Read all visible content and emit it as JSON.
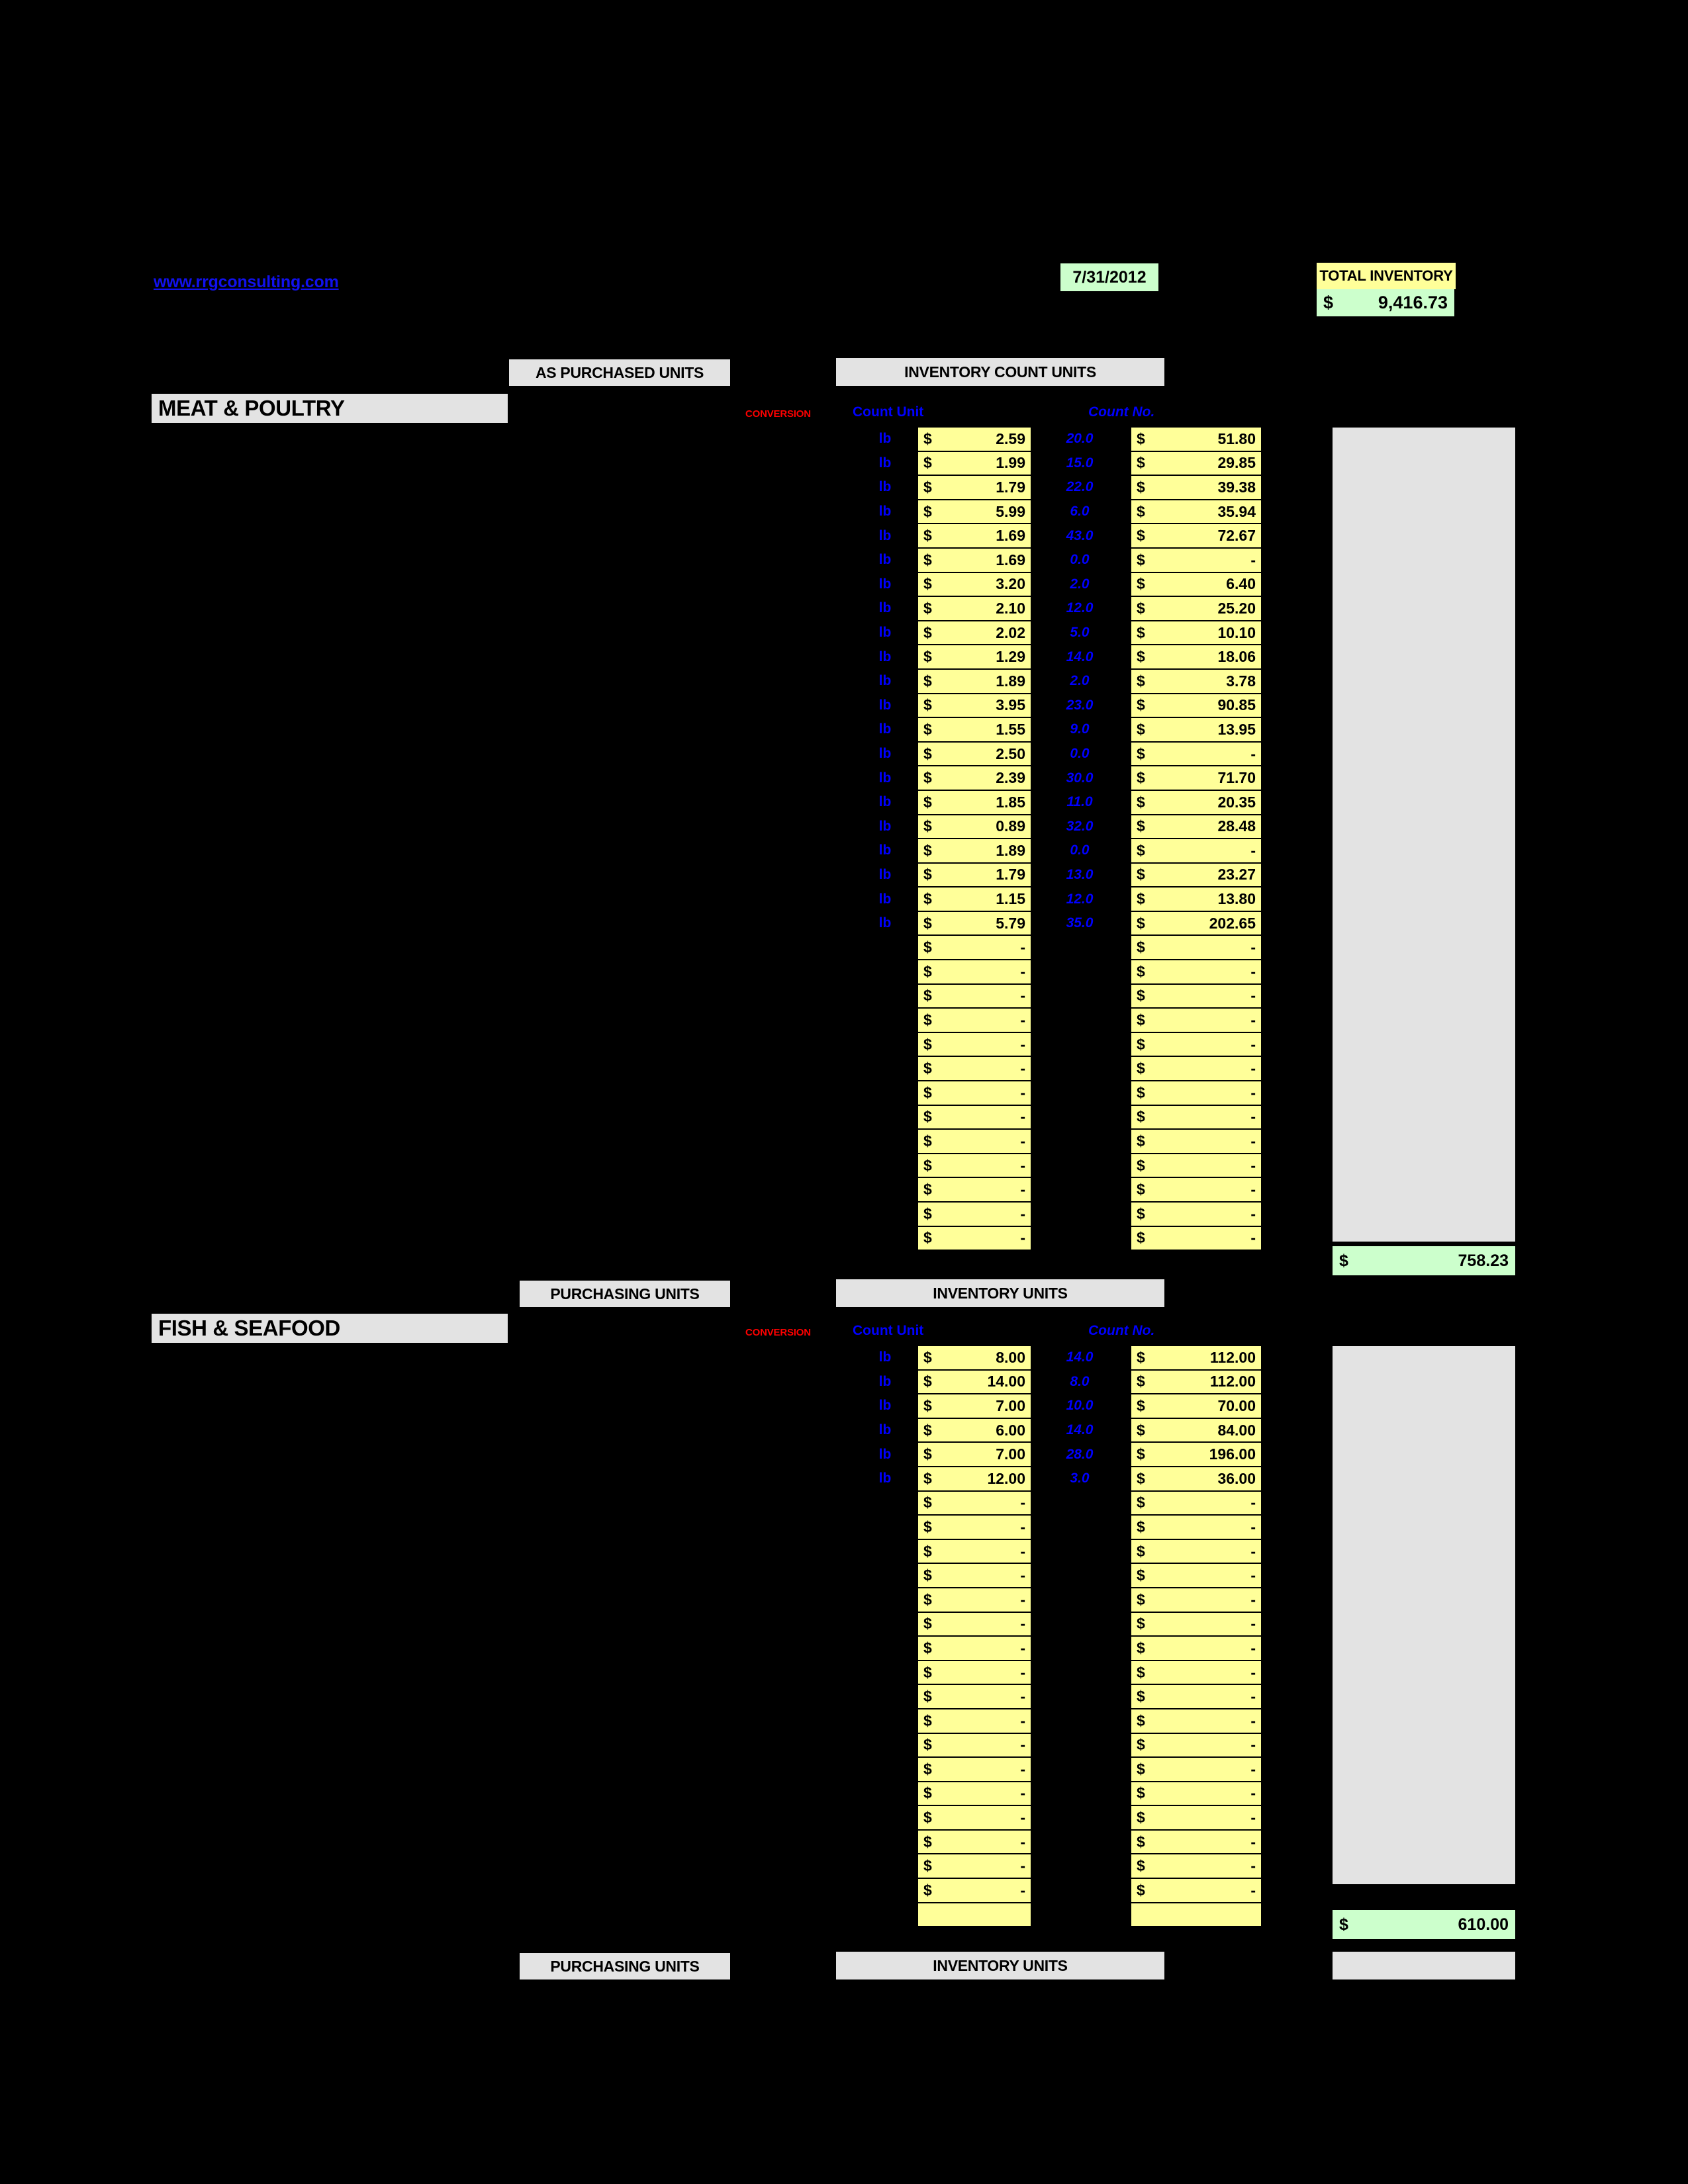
{
  "header": {
    "website": "www.rrgconsulting.com",
    "date": "7/31/2012",
    "total_inventory_label": "TOTAL INVENTORY",
    "total_inventory_currency": "$",
    "total_inventory_value": "9,416.73"
  },
  "column_labels": {
    "conversion": "CONVERSION",
    "count_unit": "Count Unit",
    "count_no": "Count No.",
    "currency": "$",
    "dash": "-"
  },
  "sections": [
    {
      "name": "MEAT & POULTRY",
      "purchase_band": "AS PURCHASED UNITS",
      "inventory_band": "INVENTORY COUNT UNITS",
      "subtotal_currency": "$",
      "subtotal": "758.23",
      "filled_row_count": 20,
      "empty_row_count": 13,
      "rows": [
        {
          "unit": "lb",
          "price": "2.59",
          "count": "20.0",
          "ext": "51.80"
        },
        {
          "unit": "lb",
          "price": "1.99",
          "count": "15.0",
          "ext": "29.85"
        },
        {
          "unit": "lb",
          "price": "1.79",
          "count": "22.0",
          "ext": "39.38"
        },
        {
          "unit": "lb",
          "price": "5.99",
          "count": "6.0",
          "ext": "35.94"
        },
        {
          "unit": "lb",
          "price": "1.69",
          "count": "43.0",
          "ext": "72.67"
        },
        {
          "unit": "lb",
          "price": "1.69",
          "count": "0.0",
          "ext": "-"
        },
        {
          "unit": "lb",
          "price": "3.20",
          "count": "2.0",
          "ext": "6.40"
        },
        {
          "unit": "lb",
          "price": "2.10",
          "count": "12.0",
          "ext": "25.20"
        },
        {
          "unit": "lb",
          "price": "2.02",
          "count": "5.0",
          "ext": "10.10"
        },
        {
          "unit": "lb",
          "price": "1.29",
          "count": "14.0",
          "ext": "18.06"
        },
        {
          "unit": "lb",
          "price": "1.89",
          "count": "2.0",
          "ext": "3.78"
        },
        {
          "unit": "lb",
          "price": "3.95",
          "count": "23.0",
          "ext": "90.85"
        },
        {
          "unit": "lb",
          "price": "1.55",
          "count": "9.0",
          "ext": "13.95"
        },
        {
          "unit": "lb",
          "price": "2.50",
          "count": "0.0",
          "ext": "-"
        },
        {
          "unit": "lb",
          "price": "2.39",
          "count": "30.0",
          "ext": "71.70"
        },
        {
          "unit": "lb",
          "price": "1.85",
          "count": "11.0",
          "ext": "20.35"
        },
        {
          "unit": "lb",
          "price": "0.89",
          "count": "32.0",
          "ext": "28.48"
        },
        {
          "unit": "lb",
          "price": "1.89",
          "count": "0.0",
          "ext": "-"
        },
        {
          "unit": "lb",
          "price": "1.79",
          "count": "13.0",
          "ext": "23.27"
        },
        {
          "unit": "lb",
          "price": "1.15",
          "count": "12.0",
          "ext": "13.80"
        },
        {
          "unit": "lb",
          "price": "5.79",
          "count": "35.0",
          "ext": "202.65"
        }
      ]
    },
    {
      "name": "FISH & SEAFOOD",
      "purchase_band": "PURCHASING UNITS",
      "inventory_band": "INVENTORY UNITS",
      "subtotal_currency": "$",
      "subtotal": "610.00",
      "filled_row_count": 6,
      "empty_row_count": 17,
      "rows": [
        {
          "unit": "lb",
          "price": "8.00",
          "count": "14.0",
          "ext": "112.00"
        },
        {
          "unit": "lb",
          "price": "14.00",
          "count": "8.0",
          "ext": "112.00"
        },
        {
          "unit": "lb",
          "price": "7.00",
          "count": "10.0",
          "ext": "70.00"
        },
        {
          "unit": "lb",
          "price": "6.00",
          "count": "14.0",
          "ext": "84.00"
        },
        {
          "unit": "lb",
          "price": "7.00",
          "count": "28.0",
          "ext": "196.00"
        },
        {
          "unit": "lb",
          "price": "12.00",
          "count": "3.0",
          "ext": "36.00"
        }
      ]
    }
  ],
  "footer": {
    "purchase_band": "PURCHASING UNITS",
    "inventory_band": "INVENTORY UNITS"
  }
}
